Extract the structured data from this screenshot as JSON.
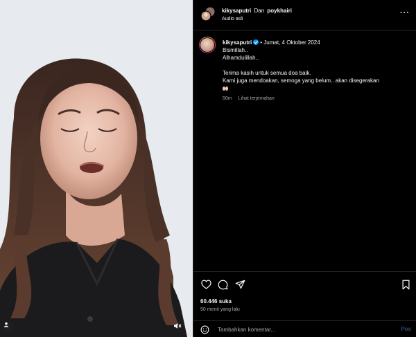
{
  "header": {
    "primary_user": "kikysaputri",
    "connector": "Dan",
    "collab_user": "poykhairi",
    "audio": "Audio asli",
    "more_icon": "more-horizontal-icon"
  },
  "caption": {
    "username": "kikysaputri",
    "separator": "•",
    "date": "Jumat, 4 Oktober 2024",
    "lines": [
      "Bismillah..",
      "Alhamdulillah..",
      "",
      "Terima kasih untuk semua doa baik.",
      "Kami juga mendoakan, semoga yang belum.. akan disegerakan"
    ],
    "emoji": "🫶",
    "age": "50m",
    "translate": "Lihat terjemahan"
  },
  "actions": {
    "icons": [
      "heart-icon",
      "comment-icon",
      "share-icon",
      "bookmark-icon"
    ]
  },
  "stats": {
    "likes": "60.446 suka",
    "posted": "50 menit yang lalu"
  },
  "comment": {
    "placeholder": "Tambahkan komentar...",
    "post_label": "Pos"
  },
  "colors": {
    "background": "#000000",
    "text": "#f5f5f5",
    "muted": "#a8a8a8",
    "divider": "#262626",
    "verified": "#0095f6",
    "post_disabled": "#2f4b7a"
  }
}
